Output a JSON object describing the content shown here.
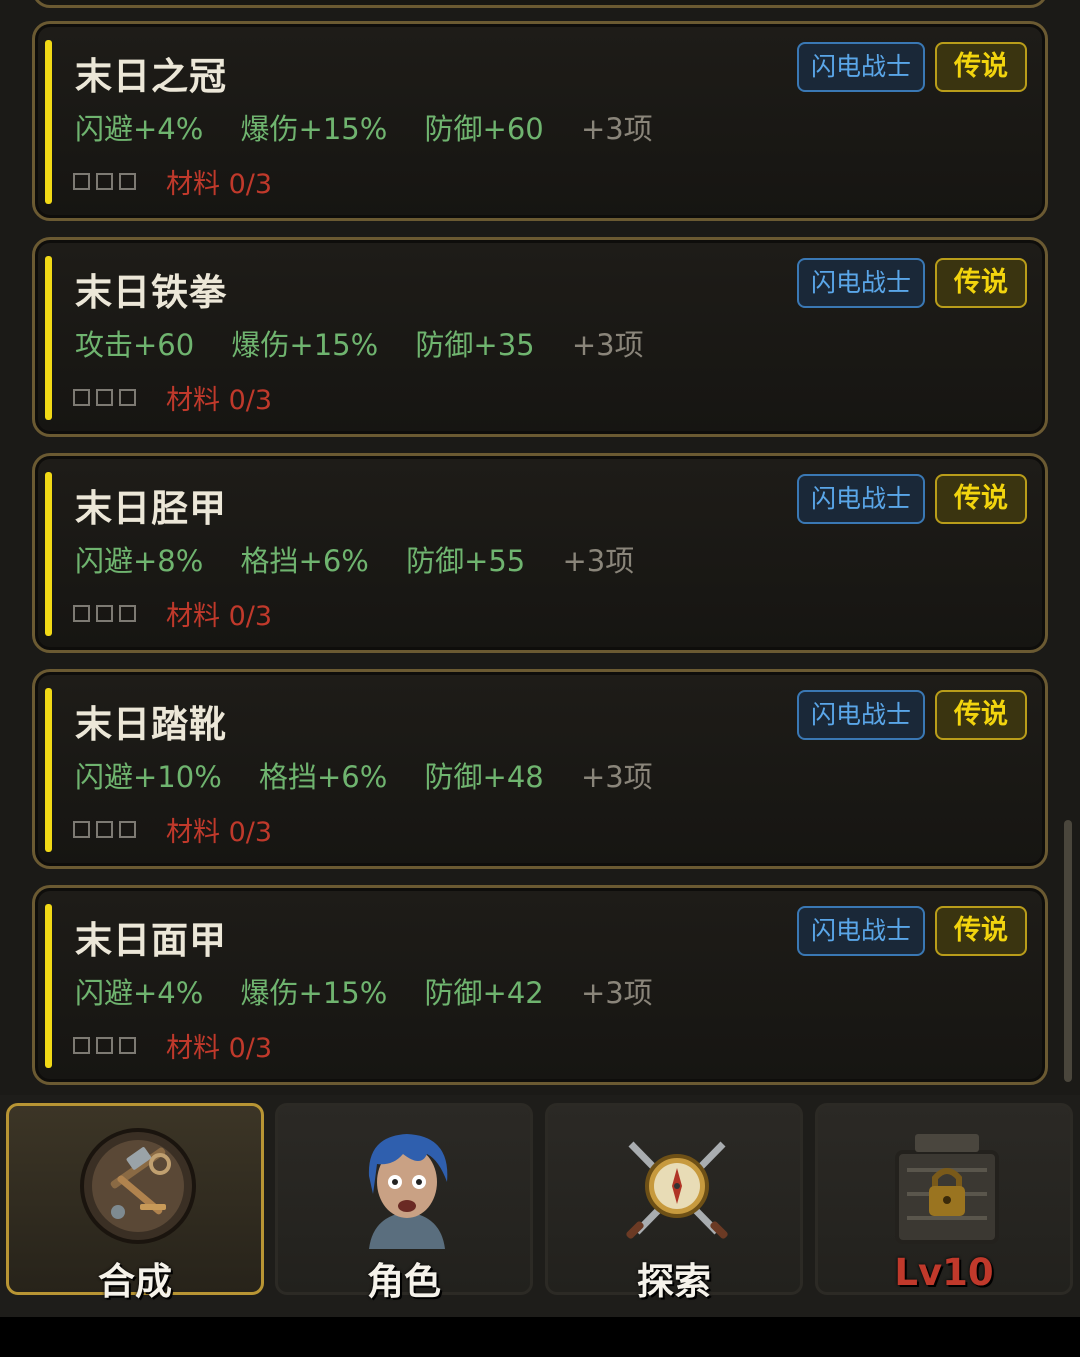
{
  "items": [
    {
      "name": "末日之冠",
      "class_tag": "闪电战士",
      "rarity_tag": "传说",
      "stats": [
        "闪避+4%",
        "爆伤+15%",
        "防御+60"
      ],
      "more": "+3项",
      "slots": "□□□",
      "material": "材料 0/3"
    },
    {
      "name": "末日铁拳",
      "class_tag": "闪电战士",
      "rarity_tag": "传说",
      "stats": [
        "攻击+60",
        "爆伤+15%",
        "防御+35"
      ],
      "more": "+3项",
      "slots": "□□□",
      "material": "材料 0/3"
    },
    {
      "name": "末日胫甲",
      "class_tag": "闪电战士",
      "rarity_tag": "传说",
      "stats": [
        "闪避+8%",
        "格挡+6%",
        "防御+55"
      ],
      "more": "+3项",
      "slots": "□□□",
      "material": "材料 0/3"
    },
    {
      "name": "末日踏靴",
      "class_tag": "闪电战士",
      "rarity_tag": "传说",
      "stats": [
        "闪避+10%",
        "格挡+6%",
        "防御+48"
      ],
      "more": "+3项",
      "slots": "□□□",
      "material": "材料 0/3"
    },
    {
      "name": "末日面甲",
      "class_tag": "闪电战士",
      "rarity_tag": "传说",
      "stats": [
        "闪避+4%",
        "爆伤+15%",
        "防御+42"
      ],
      "more": "+3项",
      "slots": "□□□",
      "material": "材料 0/3"
    }
  ],
  "nav": [
    {
      "label": "合成",
      "icon": "crafting-tools-icon",
      "active": true
    },
    {
      "label": "角色",
      "icon": "character-portrait-icon",
      "active": false
    },
    {
      "label": "探索",
      "icon": "compass-icon",
      "active": false
    },
    {
      "label": "Lv10",
      "icon": "locked-shop-icon",
      "active": false
    }
  ],
  "colors": {
    "rarity": "#f1d916",
    "stat": "#6fb46f",
    "material": "#c0392b",
    "class_tag": "#5aa6e8",
    "border": "#6b5a32"
  }
}
